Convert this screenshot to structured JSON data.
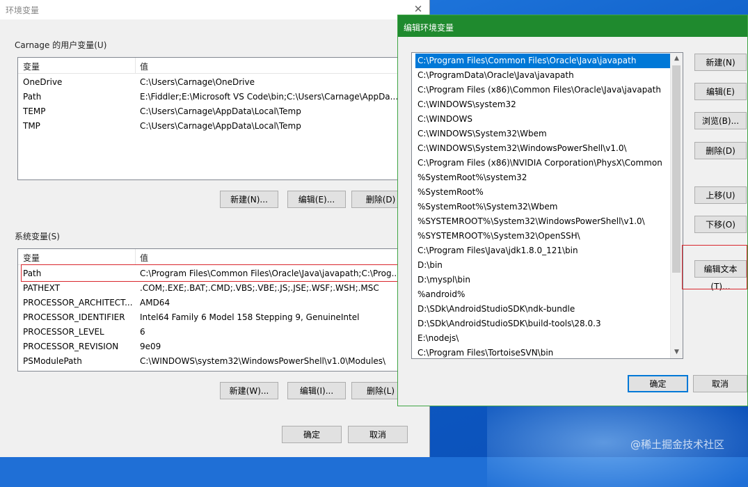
{
  "env_dialog": {
    "title": "环境变量",
    "close_glyph": "✕",
    "user_section": {
      "label": "Carnage 的用户变量(U)",
      "columns": [
        "变量",
        "值"
      ],
      "rows": [
        {
          "name": "OneDrive",
          "value": "C:\\Users\\Carnage\\OneDrive"
        },
        {
          "name": "Path",
          "value": "E:\\Fiddler;E:\\Microsoft VS Code\\bin;C:\\Users\\Carnage\\AppDa..."
        },
        {
          "name": "TEMP",
          "value": "C:\\Users\\Carnage\\AppData\\Local\\Temp"
        },
        {
          "name": "TMP",
          "value": "C:\\Users\\Carnage\\AppData\\Local\\Temp"
        }
      ],
      "buttons": {
        "new": "新建(N)...",
        "edit": "编辑(E)...",
        "delete": "删除(D)"
      }
    },
    "system_section": {
      "label": "系统变量(S)",
      "columns": [
        "变量",
        "值"
      ],
      "rows": [
        {
          "name": "Path",
          "value": "C:\\Program Files\\Common Files\\Oracle\\Java\\javapath;C:\\Prog..."
        },
        {
          "name": "PATHEXT",
          "value": ".COM;.EXE;.BAT;.CMD;.VBS;.VBE;.JS;.JSE;.WSF;.WSH;.MSC"
        },
        {
          "name": "PROCESSOR_ARCHITECT...",
          "value": "AMD64"
        },
        {
          "name": "PROCESSOR_IDENTIFIER",
          "value": "Intel64 Family 6 Model 158 Stepping 9, GenuineIntel"
        },
        {
          "name": "PROCESSOR_LEVEL",
          "value": "6"
        },
        {
          "name": "PROCESSOR_REVISION",
          "value": "9e09"
        },
        {
          "name": "PSModulePath",
          "value": "C:\\WINDOWS\\system32\\WindowsPowerShell\\v1.0\\Modules\\"
        }
      ],
      "buttons": {
        "new": "新建(W)...",
        "edit": "编辑(I)...",
        "delete": "删除(L)"
      }
    },
    "footer": {
      "ok": "确定",
      "cancel": "取消"
    }
  },
  "edit_dialog": {
    "title": "编辑环境变量",
    "paths": [
      "C:\\Program Files\\Common Files\\Oracle\\Java\\javapath",
      "C:\\ProgramData\\Oracle\\Java\\javapath",
      "C:\\Program Files (x86)\\Common Files\\Oracle\\Java\\javapath",
      "C:\\WINDOWS\\system32",
      "C:\\WINDOWS",
      "C:\\WINDOWS\\System32\\Wbem",
      "C:\\WINDOWS\\System32\\WindowsPowerShell\\v1.0\\",
      "C:\\Program Files (x86)\\NVIDIA Corporation\\PhysX\\Common",
      "%SystemRoot%\\system32",
      "%SystemRoot%",
      "%SystemRoot%\\System32\\Wbem",
      "%SYSTEMROOT%\\System32\\WindowsPowerShell\\v1.0\\",
      "%SYSTEMROOT%\\System32\\OpenSSH\\",
      "C:\\Program Files\\Java\\jdk1.8.0_121\\bin",
      "D:\\bin",
      "D:\\myspl\\bin",
      "%android%",
      "D:\\SDk\\AndroidStudioSDK\\ndk-bundle",
      "D:\\SDk\\AndroidStudioSDK\\build-tools\\28.0.3",
      "E:\\nodejs\\",
      "C:\\Program Files\\TortoiseSVN\\bin"
    ],
    "selected_index": 0,
    "buttons": {
      "new": "新建(N)",
      "edit": "编辑(E)",
      "browse": "浏览(B)...",
      "delete": "删除(D)",
      "move_up": "上移(U)",
      "move_down": "下移(O)",
      "edit_text": "编辑文本(T)..."
    },
    "footer": {
      "ok": "确定",
      "cancel": "取消"
    }
  },
  "watermark": "@稀土掘金技术社区",
  "colors": {
    "selection": "#0078d7",
    "edit_titlebar": "#1f8a2e",
    "highlight_box": "#d9262c"
  }
}
